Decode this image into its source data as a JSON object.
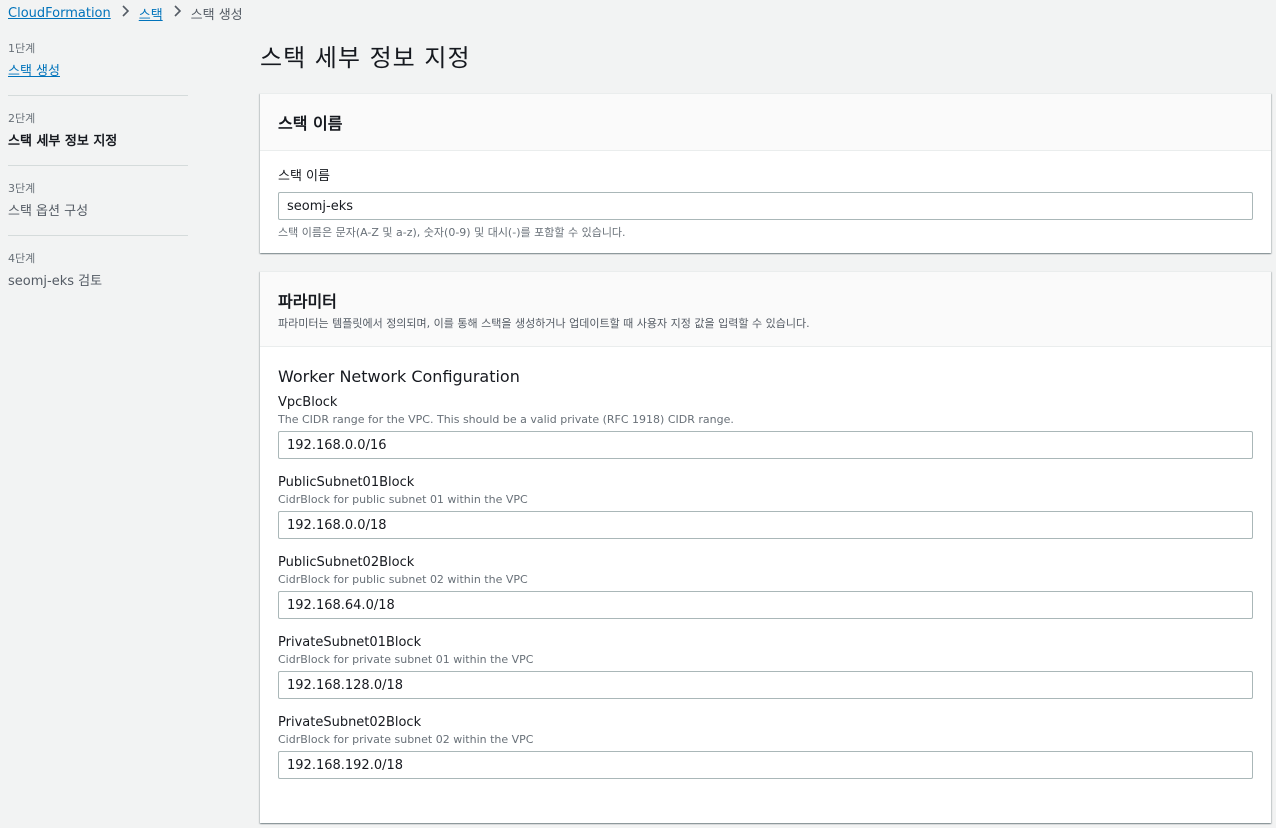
{
  "breadcrumb": {
    "items": [
      "CloudFormation",
      "스택",
      "스택 생성"
    ]
  },
  "sidebar": {
    "steps": [
      {
        "num": "1단계",
        "label": "스택 생성"
      },
      {
        "num": "2단계",
        "label": "스택 세부 정보 지정"
      },
      {
        "num": "3단계",
        "label": "스택 옵션 구성"
      },
      {
        "num": "4단계",
        "label": "seomj-eks 검토"
      }
    ]
  },
  "page": {
    "title": "스택 세부 정보 지정"
  },
  "stack_name_panel": {
    "header": "스택 이름",
    "label": "스택 이름",
    "value": "seomj-eks",
    "hint": "스택 이름은 문자(A-Z 및 a-z), 숫자(0-9) 및 대시(-)를 포함할 수 있습니다."
  },
  "params_panel": {
    "header": "파라미터",
    "description": "파라미터는 템플릿에서 정의되며, 이를 통해 스택을 생성하거나 업데이트할 때 사용자 지정 값을 입력할 수 있습니다.",
    "section_title": "Worker Network Configuration",
    "fields": [
      {
        "label": "VpcBlock",
        "desc": "The CIDR range for the VPC. This should be a valid private (RFC 1918) CIDR range.",
        "value": "192.168.0.0/16"
      },
      {
        "label": "PublicSubnet01Block",
        "desc": "CidrBlock for public subnet 01 within the VPC",
        "value": "192.168.0.0/18"
      },
      {
        "label": "PublicSubnet02Block",
        "desc": "CidrBlock for public subnet 02 within the VPC",
        "value": "192.168.64.0/18"
      },
      {
        "label": "PrivateSubnet01Block",
        "desc": "CidrBlock for private subnet 01 within the VPC",
        "value": "192.168.128.0/18"
      },
      {
        "label": "PrivateSubnet02Block",
        "desc": "CidrBlock for private subnet 02 within the VPC",
        "value": "192.168.192.0/18"
      }
    ]
  }
}
